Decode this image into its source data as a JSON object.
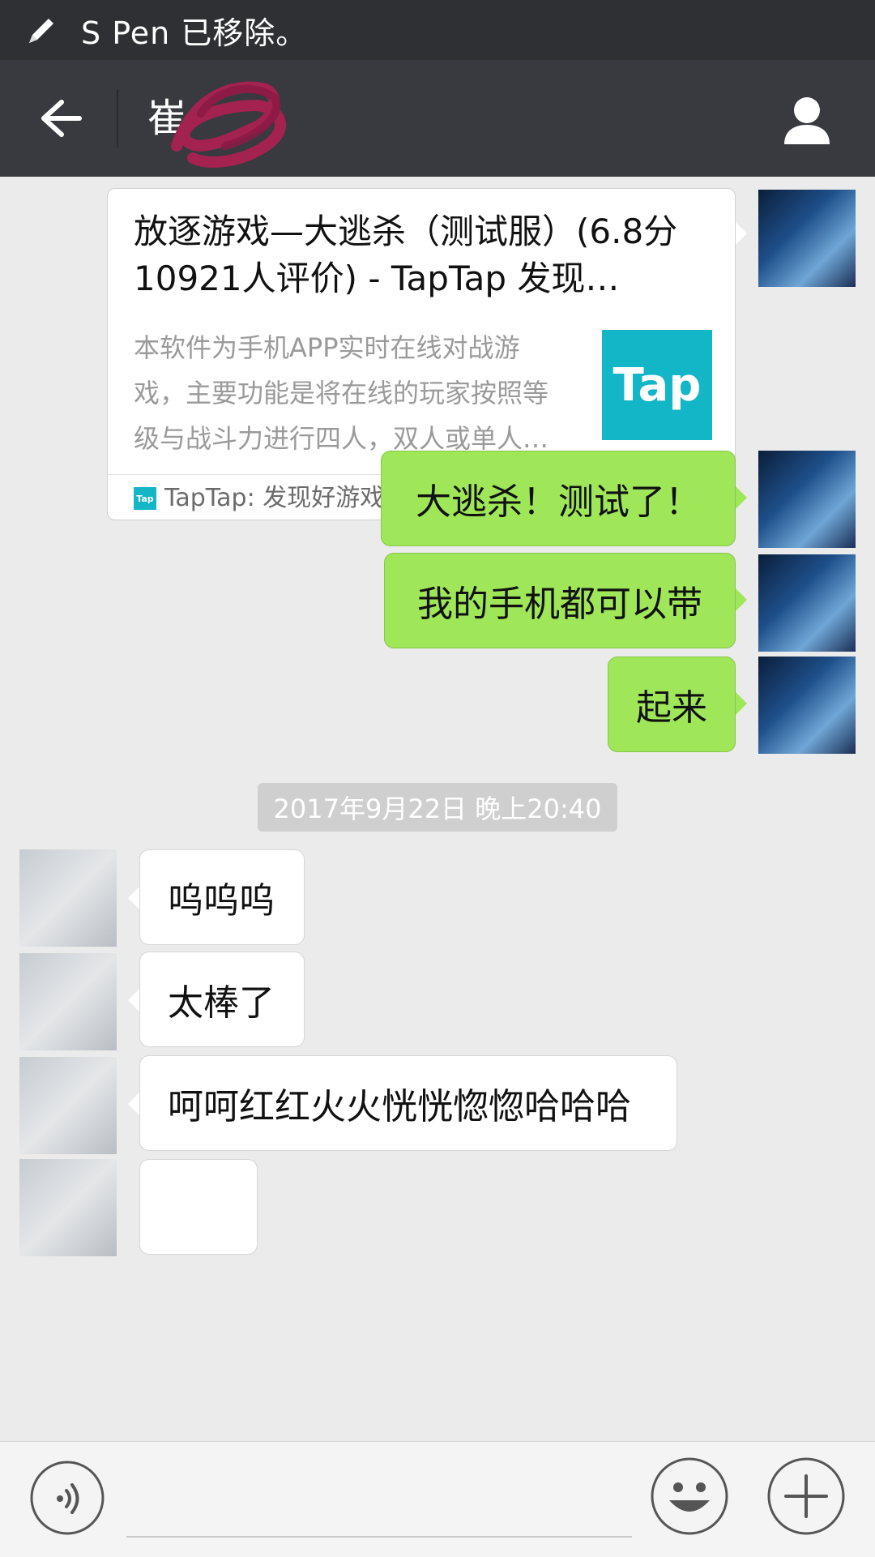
{
  "status_bar": {
    "text": "S Pen 已移除。"
  },
  "header": {
    "title": "崔"
  },
  "link_card": {
    "title": "放逐游戏—大逃杀（测试服）(6.8分 10921人评价) - TapTap 发现…",
    "description": "本软件为手机APP实时在线对战游戏，主要功能是将在线的玩家按照等级与战斗力进行四人，双人或单人…",
    "thumbnail_text": "Tap",
    "source_icon_text": "Tap",
    "source": "TapTap: 发现好游戏"
  },
  "messages_sent": [
    {
      "text": "大逃杀！测试了！"
    },
    {
      "text": "我的手机都可以带"
    },
    {
      "text": "起来"
    }
  ],
  "timestamp": "2017年9月22日 晚上20:40",
  "messages_received": [
    {
      "text": "呜呜呜"
    },
    {
      "text": "太棒了"
    },
    {
      "text": "呵呵红红火火恍恍惚惚哈哈哈"
    },
    {
      "text": ""
    }
  ],
  "colors": {
    "status_bar": "#2e3033",
    "title_bar": "#393a3f",
    "chat_bg": "#ebebeb",
    "sent_bubble": "#9fe658",
    "received_bubble": "#ffffff",
    "tap_brand": "#13b6c6"
  },
  "icons": {
    "status": "pen-icon",
    "back": "back-arrow-icon",
    "profile": "person-icon",
    "voice": "voice-icon",
    "emoji": "emoji-icon",
    "more": "plus-icon"
  }
}
